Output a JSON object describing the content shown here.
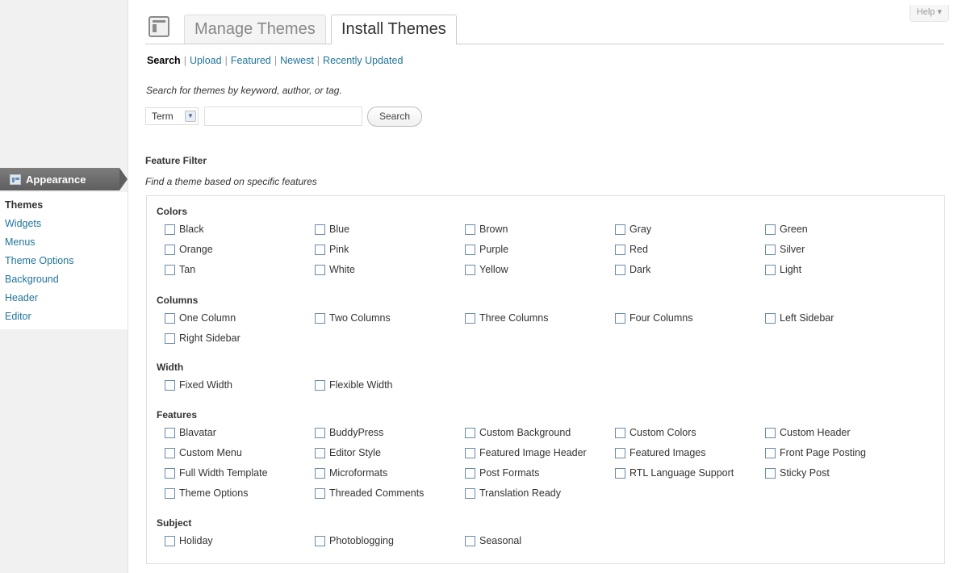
{
  "menu": {
    "head_label": "Appearance",
    "items": [
      {
        "label": "Themes",
        "current": true
      },
      {
        "label": "Widgets"
      },
      {
        "label": "Menus"
      },
      {
        "label": "Theme Options"
      },
      {
        "label": "Background"
      },
      {
        "label": "Header"
      },
      {
        "label": "Editor"
      }
    ]
  },
  "header": {
    "help_label": "Help ▾",
    "tabs": [
      {
        "label": "Manage Themes",
        "active": false
      },
      {
        "label": "Install Themes",
        "active": true
      }
    ]
  },
  "subnav": {
    "items": [
      "Search",
      "Upload",
      "Featured",
      "Newest",
      "Recently Updated"
    ],
    "current": "Search"
  },
  "search": {
    "description": "Search for themes by keyword, author, or tag.",
    "type_selected": "Term",
    "input_value": "",
    "button_label": "Search"
  },
  "filter": {
    "title": "Feature Filter",
    "description": "Find a theme based on specific features",
    "groups": [
      {
        "title": "Colors",
        "options": [
          "Black",
          "Blue",
          "Brown",
          "Gray",
          "Green",
          "Orange",
          "Pink",
          "Purple",
          "Red",
          "Silver",
          "Tan",
          "White",
          "Yellow",
          "Dark",
          "Light"
        ]
      },
      {
        "title": "Columns",
        "options": [
          "One Column",
          "Two Columns",
          "Three Columns",
          "Four Columns",
          "Left Sidebar",
          "Right Sidebar"
        ]
      },
      {
        "title": "Width",
        "options": [
          "Fixed Width",
          "Flexible Width"
        ]
      },
      {
        "title": "Features",
        "options": [
          "Blavatar",
          "BuddyPress",
          "Custom Background",
          "Custom Colors",
          "Custom Header",
          "Custom Menu",
          "Editor Style",
          "Featured Image Header",
          "Featured Images",
          "Front Page Posting",
          "Full Width Template",
          "Microformats",
          "Post Formats",
          "RTL Language Support",
          "Sticky Post",
          "Theme Options",
          "Threaded Comments",
          "Translation Ready"
        ]
      },
      {
        "title": "Subject",
        "options": [
          "Holiday",
          "Photoblogging",
          "Seasonal"
        ]
      }
    ]
  }
}
